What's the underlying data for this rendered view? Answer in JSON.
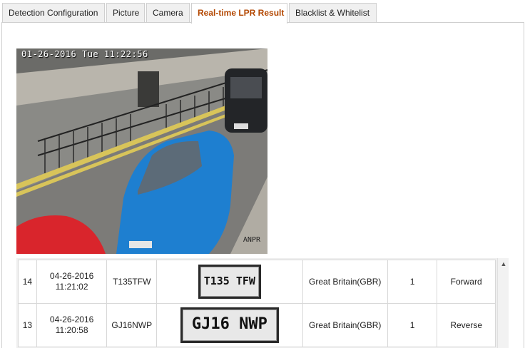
{
  "tabs": [
    {
      "label": "Detection Configuration",
      "active": false
    },
    {
      "label": "Picture",
      "active": false
    },
    {
      "label": "Camera",
      "active": false
    },
    {
      "label": "Real-time LPR Result",
      "active": true
    },
    {
      "label": "Blacklist & Whitelist",
      "active": false
    }
  ],
  "video": {
    "timestamp": "01-26-2016 Tue 11:22:56",
    "brand": "ANPR"
  },
  "results": [
    {
      "index": "14",
      "date": "04-26-2016",
      "time": "11:21:02",
      "plate": "T135TFW",
      "plate_image_text": "T135 TFW",
      "country": "Great Britain(GBR)",
      "count": "1",
      "direction": "Forward"
    },
    {
      "index": "13",
      "date": "04-26-2016",
      "time": "11:20:58",
      "plate": "GJ16NWP",
      "plate_image_text": "GJ16 NWP",
      "country": "Great Britain(GBR)",
      "count": "1",
      "direction": "Reverse"
    }
  ],
  "colors": {
    "active_tab_text": "#b34700",
    "car_blue": "#1e7fd0",
    "car_red": "#d9252c"
  }
}
